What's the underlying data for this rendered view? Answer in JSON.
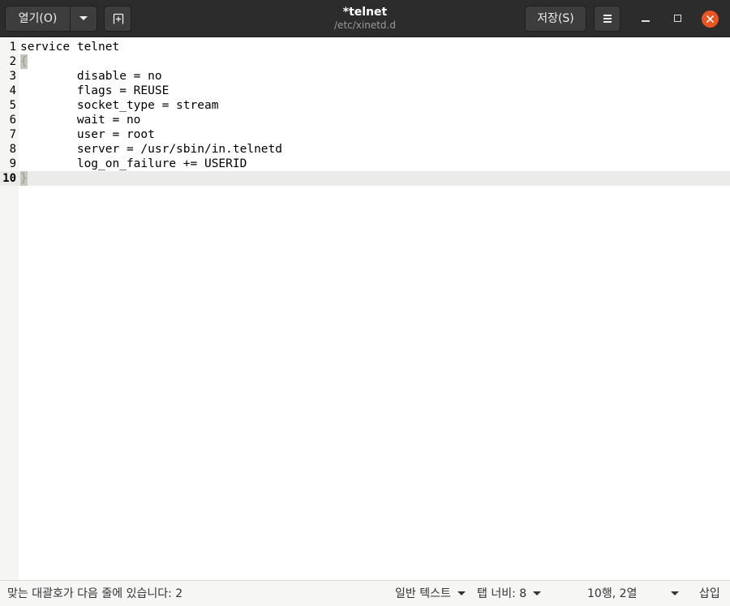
{
  "headerbar": {
    "open_label": "열기(O)",
    "save_label": "저장(S)",
    "title": "*telnet",
    "subtitle": "/etc/xinetd.d"
  },
  "editor": {
    "lines": [
      {
        "num": "1",
        "text": "service telnet"
      },
      {
        "num": "2",
        "text": "{"
      },
      {
        "num": "3",
        "text": "        disable = no"
      },
      {
        "num": "4",
        "text": "        flags = REUSE"
      },
      {
        "num": "5",
        "text": "        socket_type = stream"
      },
      {
        "num": "6",
        "text": "        wait = no"
      },
      {
        "num": "7",
        "text": "        user = root"
      },
      {
        "num": "8",
        "text": "        server = /usr/sbin/in.telnetd"
      },
      {
        "num": "9",
        "text": "        log_on_failure += USERID"
      },
      {
        "num": "10",
        "text": "}"
      }
    ],
    "current_line": 10
  },
  "statusbar": {
    "message": "맞는 대괄호가 다음 줄에 있습니다: 2",
    "language": "일반 텍스트",
    "tab_width": "탭 너비: 8",
    "position": "10행, 2열",
    "insert_mode": "삽입"
  },
  "colors": {
    "headerbar_bg": "#2c2c2c",
    "close_button": "#e95420",
    "current_line_bg": "#ebebe9"
  }
}
